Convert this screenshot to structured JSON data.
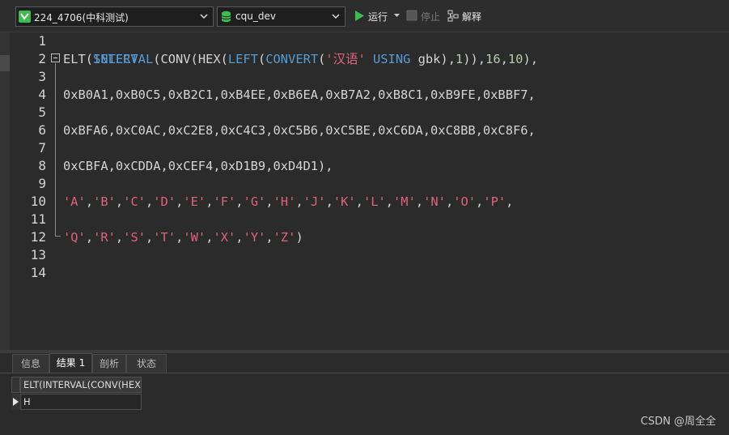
{
  "toolbar": {
    "connection": {
      "value": "224_4706(中科测试)",
      "icon": "connection-icon"
    },
    "database": {
      "value": "cqu_dev",
      "icon": "database-icon"
    },
    "run_label": "运行",
    "stop_label": "停止",
    "explain_label": "解释",
    "colors": {
      "run": "#3fb950",
      "db_icon": "#3fb950"
    }
  },
  "editor": {
    "line_numbers": [
      "1",
      "2",
      "3",
      "4",
      "5",
      "6",
      "7",
      "8",
      "9",
      "10",
      "11",
      "12",
      "13",
      "14"
    ],
    "lines": {
      "l1": [
        "SELECT"
      ],
      "l2": [
        "ELT(",
        "INTERVAL",
        "(CONV(HEX(",
        "LEFT",
        "(",
        "CONVERT",
        "(",
        "'汉语'",
        " ",
        "USING",
        " gbk),",
        "1",
        ")),",
        "16",
        ",",
        "10",
        "),"
      ],
      "l4": [
        "0xB0A1,0xB0C5,0xB2C1,0xB4EE,0xB6EA,0xB7A2,0xB8C1,0xB9FE,0xBBF7,"
      ],
      "l6": [
        "0xBFA6,0xC0AC,0xC2E8,0xC4C3,0xC5B6,0xC5BE,0xC6DA,0xC8BB,0xC8F6,"
      ],
      "l8": [
        "0xCBFA,0xCDDA,0xCEF4,0xD1B9,0xD4D1),"
      ],
      "l10": [
        "'A'",
        ",",
        "'B'",
        ",",
        "'C'",
        ",",
        "'D'",
        ",",
        "'E'",
        ",",
        "'F'",
        ",",
        "'G'",
        ",",
        "'H'",
        ",",
        "'J'",
        ",",
        "'K'",
        ",",
        "'L'",
        ",",
        "'M'",
        ",",
        "'N'",
        ",",
        "'O'",
        ",",
        "'P'",
        ","
      ],
      "l12": [
        "'Q'",
        ",",
        "'R'",
        ",",
        "'S'",
        ",",
        "'T'",
        ",",
        "'W'",
        ",",
        "'X'",
        ",",
        "'Y'",
        ",",
        "'Z'",
        ")"
      ]
    },
    "colors": {
      "keyword": "#569cd6",
      "string": "#e0637a",
      "number": "#b5cea8"
    }
  },
  "result_panel": {
    "tabs": [
      "信息",
      "结果 1",
      "剖析",
      "状态"
    ],
    "active_tab": "结果 1",
    "column_header": "ELT(INTERVAL(CONV(HEX(",
    "rows": [
      [
        "H"
      ]
    ]
  },
  "watermark": "CSDN @周全全"
}
